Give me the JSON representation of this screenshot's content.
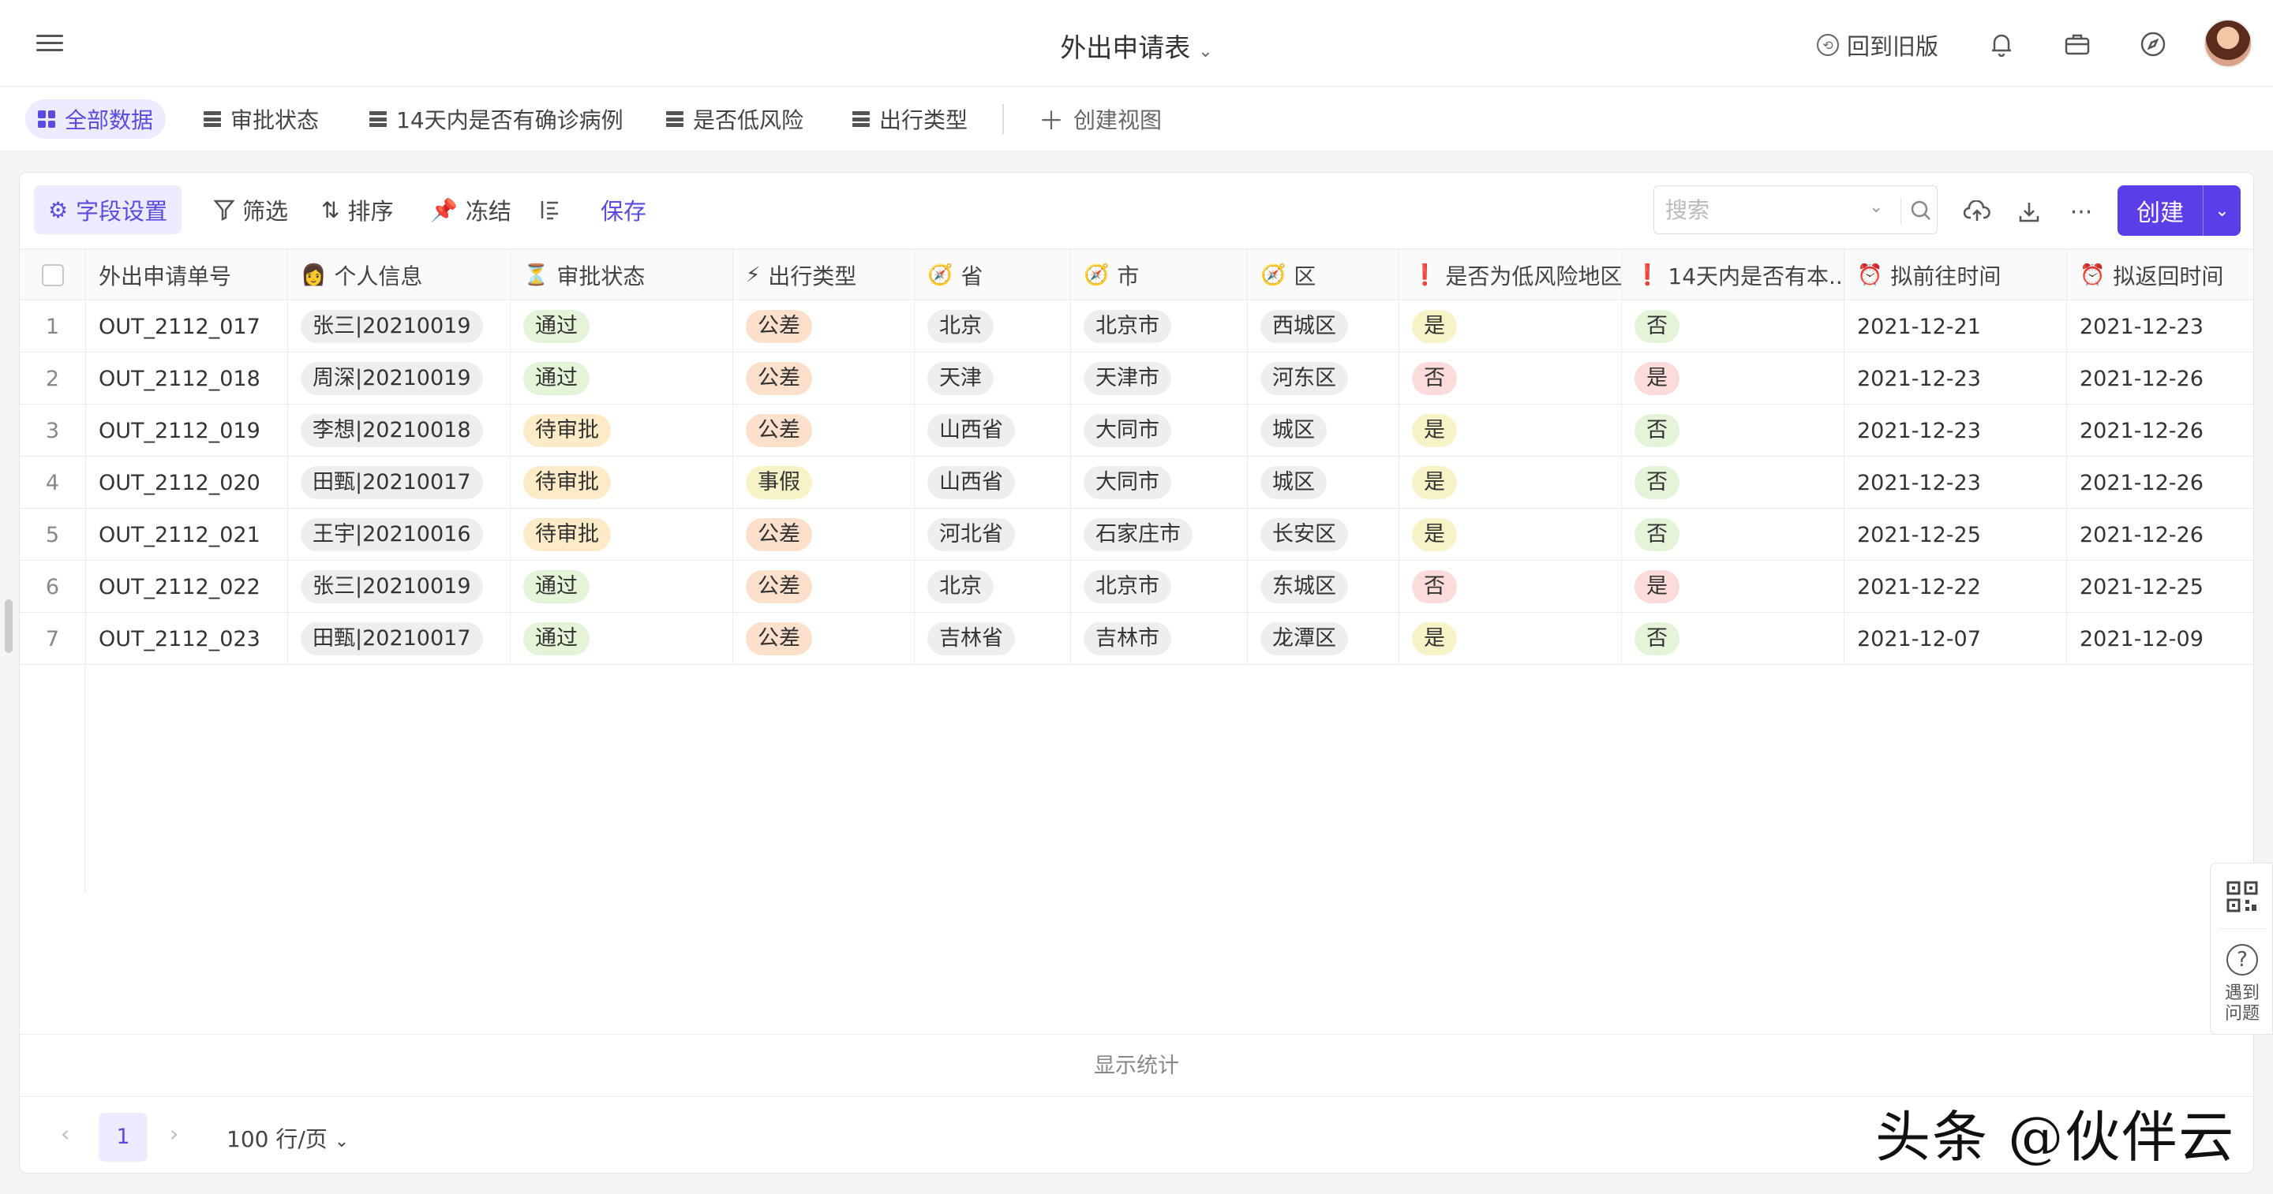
{
  "header": {
    "title": "外出申请表",
    "old_version": "回到旧版",
    "icons": [
      "menu-icon",
      "bell-icon",
      "briefcase-icon",
      "compass-icon",
      "avatar"
    ]
  },
  "views": {
    "tabs": [
      {
        "label": "全部数据",
        "active": true
      },
      {
        "label": "审批状态"
      },
      {
        "label": "14天内是否有确诊病例"
      },
      {
        "label": "是否低风险"
      },
      {
        "label": "出行类型"
      }
    ],
    "create_view": "创建视图"
  },
  "toolbar": {
    "field_settings": "字段设置",
    "filter": "筛选",
    "sort": "排序",
    "freeze": "冻结",
    "save": "保存",
    "search_placeholder": "搜索",
    "create": "创建"
  },
  "table": {
    "columns": [
      {
        "label": "外出申请单号"
      },
      {
        "label": "个人信息",
        "icon": "👩"
      },
      {
        "label": "审批状态",
        "icon": "⏳"
      },
      {
        "label": "出行类型",
        "icon": "⚡"
      },
      {
        "label": "省",
        "icon": "🧭"
      },
      {
        "label": "市",
        "icon": "🧭"
      },
      {
        "label": "区",
        "icon": "🧭"
      },
      {
        "label": "是否为低风险地区",
        "icon": "❗"
      },
      {
        "label": "14天内是否有本...",
        "icon": "❗"
      },
      {
        "label": "拟前往时间",
        "icon": "⏰"
      },
      {
        "label": "拟返回时间",
        "icon": "⏰"
      }
    ],
    "rows": [
      {
        "idx": "1",
        "id": "OUT_2112_017",
        "person": "张三|20210019",
        "status": "通过",
        "type": "公差",
        "prov": "北京",
        "city": "北京市",
        "dist": "西城区",
        "low": "是",
        "case14": "否",
        "go": "2021-12-21",
        "back": "2021-12-23"
      },
      {
        "idx": "2",
        "id": "OUT_2112_018",
        "person": "周深|20210019",
        "status": "通过",
        "type": "公差",
        "prov": "天津",
        "city": "天津市",
        "dist": "河东区",
        "low": "否",
        "case14": "是",
        "go": "2021-12-23",
        "back": "2021-12-26"
      },
      {
        "idx": "3",
        "id": "OUT_2112_019",
        "person": "李想|20210018",
        "status": "待审批",
        "type": "公差",
        "prov": "山西省",
        "city": "大同市",
        "dist": "城区",
        "low": "是",
        "case14": "否",
        "go": "2021-12-23",
        "back": "2021-12-26"
      },
      {
        "idx": "4",
        "id": "OUT_2112_020",
        "person": "田甄|20210017",
        "status": "待审批",
        "type": "事假",
        "prov": "山西省",
        "city": "大同市",
        "dist": "城区",
        "low": "是",
        "case14": "否",
        "go": "2021-12-23",
        "back": "2021-12-26"
      },
      {
        "idx": "5",
        "id": "OUT_2112_021",
        "person": "王宇|20210016",
        "status": "待审批",
        "type": "公差",
        "prov": "河北省",
        "city": "石家庄市",
        "dist": "长安区",
        "low": "是",
        "case14": "否",
        "go": "2021-12-25",
        "back": "2021-12-26"
      },
      {
        "idx": "6",
        "id": "OUT_2112_022",
        "person": "张三|20210019",
        "status": "通过",
        "type": "公差",
        "prov": "北京",
        "city": "北京市",
        "dist": "东城区",
        "low": "否",
        "case14": "是",
        "go": "2021-12-22",
        "back": "2021-12-25"
      },
      {
        "idx": "7",
        "id": "OUT_2112_023",
        "person": "田甄|20210017",
        "status": "通过",
        "type": "公差",
        "prov": "吉林省",
        "city": "吉林市",
        "dist": "龙潭区",
        "low": "是",
        "case14": "否",
        "go": "2021-12-07",
        "back": "2021-12-09"
      }
    ]
  },
  "footer": {
    "show_stats": "显示统计",
    "current_page": "1",
    "page_size": "100 行/页"
  },
  "side_float": {
    "help": "遇到问题"
  },
  "watermark": "头条 @伙伴云",
  "colors": {
    "accent": "#5b3ee8",
    "tag_pass": "#e5f3d9",
    "tag_pending": "#fcebc6",
    "tag_trip": "#fde0cc",
    "tag_yes": "#f6f4c7",
    "tag_no": "#fbdcdb"
  }
}
